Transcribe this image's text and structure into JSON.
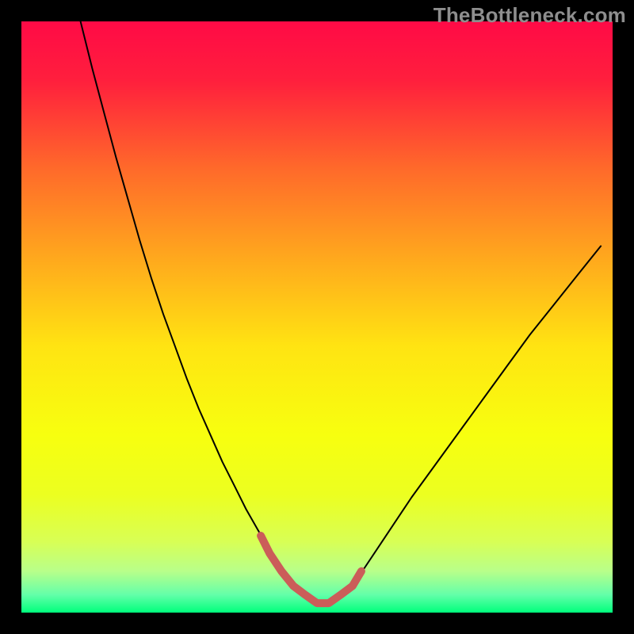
{
  "watermark": "TheBottleneck.com",
  "chart_data": {
    "type": "area",
    "title": "",
    "xlabel": "",
    "ylabel": "",
    "xlim": [
      0,
      100
    ],
    "ylim": [
      0,
      100
    ],
    "grid": false,
    "legend": false,
    "gradient_stops": [
      {
        "pos": 0.0,
        "color": "#ff0a46"
      },
      {
        "pos": 0.1,
        "color": "#ff1f3d"
      },
      {
        "pos": 0.25,
        "color": "#ff6a2a"
      },
      {
        "pos": 0.4,
        "color": "#ffa81d"
      },
      {
        "pos": 0.55,
        "color": "#ffe412"
      },
      {
        "pos": 0.7,
        "color": "#f7ff0f"
      },
      {
        "pos": 0.8,
        "color": "#ecff20"
      },
      {
        "pos": 0.88,
        "color": "#d8ff55"
      },
      {
        "pos": 0.93,
        "color": "#b8ff8a"
      },
      {
        "pos": 0.97,
        "color": "#63ffa9"
      },
      {
        "pos": 1.0,
        "color": "#00ff7c"
      }
    ],
    "series": [
      {
        "name": "curve",
        "stroke": "#000000",
        "stroke_width": 2,
        "x": [
          10,
          12,
          14,
          16,
          18,
          20,
          22,
          24,
          26,
          28,
          30,
          32,
          34,
          36,
          38,
          40,
          42,
          44,
          46,
          48,
          50,
          52,
          54,
          56,
          58,
          60,
          63,
          66,
          70,
          74,
          78,
          82,
          86,
          90,
          94,
          98
        ],
        "values": [
          100,
          92,
          84.5,
          77,
          70,
          63,
          56.5,
          50.5,
          45,
          39.5,
          34.5,
          30,
          25.5,
          21.5,
          17.5,
          14,
          10.5,
          7.5,
          5,
          3,
          1.6,
          1.6,
          3,
          5,
          7.5,
          10.5,
          15,
          19.5,
          25,
          30.5,
          36,
          41.5,
          47,
          52,
          57,
          62
        ]
      },
      {
        "name": "flat-segment",
        "stroke": "#cb5d59",
        "stroke_width": 10,
        "linecap": "round",
        "x": [
          40.5,
          42,
          44,
          46,
          48,
          50,
          52,
          54,
          56,
          57.5
        ],
        "values": [
          13.0,
          10.0,
          7.0,
          4.5,
          3.0,
          1.6,
          1.6,
          3.0,
          4.5,
          7.0
        ]
      }
    ]
  }
}
